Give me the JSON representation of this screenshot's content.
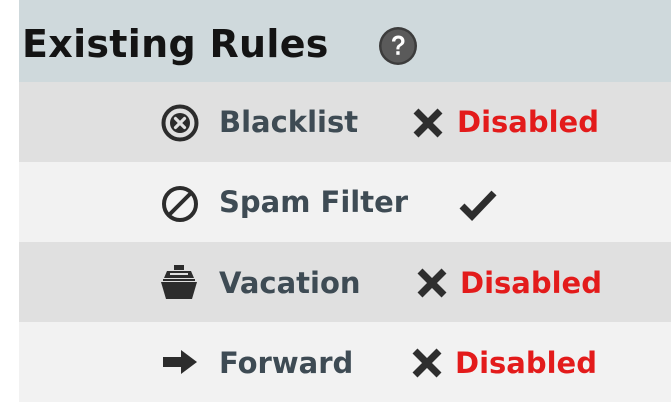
{
  "header": {
    "title": "Existing Rules",
    "help_icon": "question-circle-icon"
  },
  "colors": {
    "header_bg": "#cfd9dc",
    "row_dark": "#e0e0e0",
    "row_light": "#f2f2f2",
    "label": "#3e4b54",
    "disabled": "#e31b1b"
  },
  "rules": [
    {
      "label": "Blacklist",
      "icon": "x-circle-icon",
      "enabled": false,
      "status_icon": "x-icon",
      "status_text": "Disabled"
    },
    {
      "label": "Spam Filter",
      "icon": "prohibited-icon",
      "enabled": true,
      "status_icon": "checkmark-icon",
      "status_text": ""
    },
    {
      "label": "Vacation",
      "icon": "cruise-ship-icon",
      "enabled": false,
      "status_icon": "x-icon",
      "status_text": "Disabled"
    },
    {
      "label": "Forward",
      "icon": "arrow-right-icon",
      "enabled": false,
      "status_icon": "x-icon",
      "status_text": "Disabled"
    }
  ]
}
